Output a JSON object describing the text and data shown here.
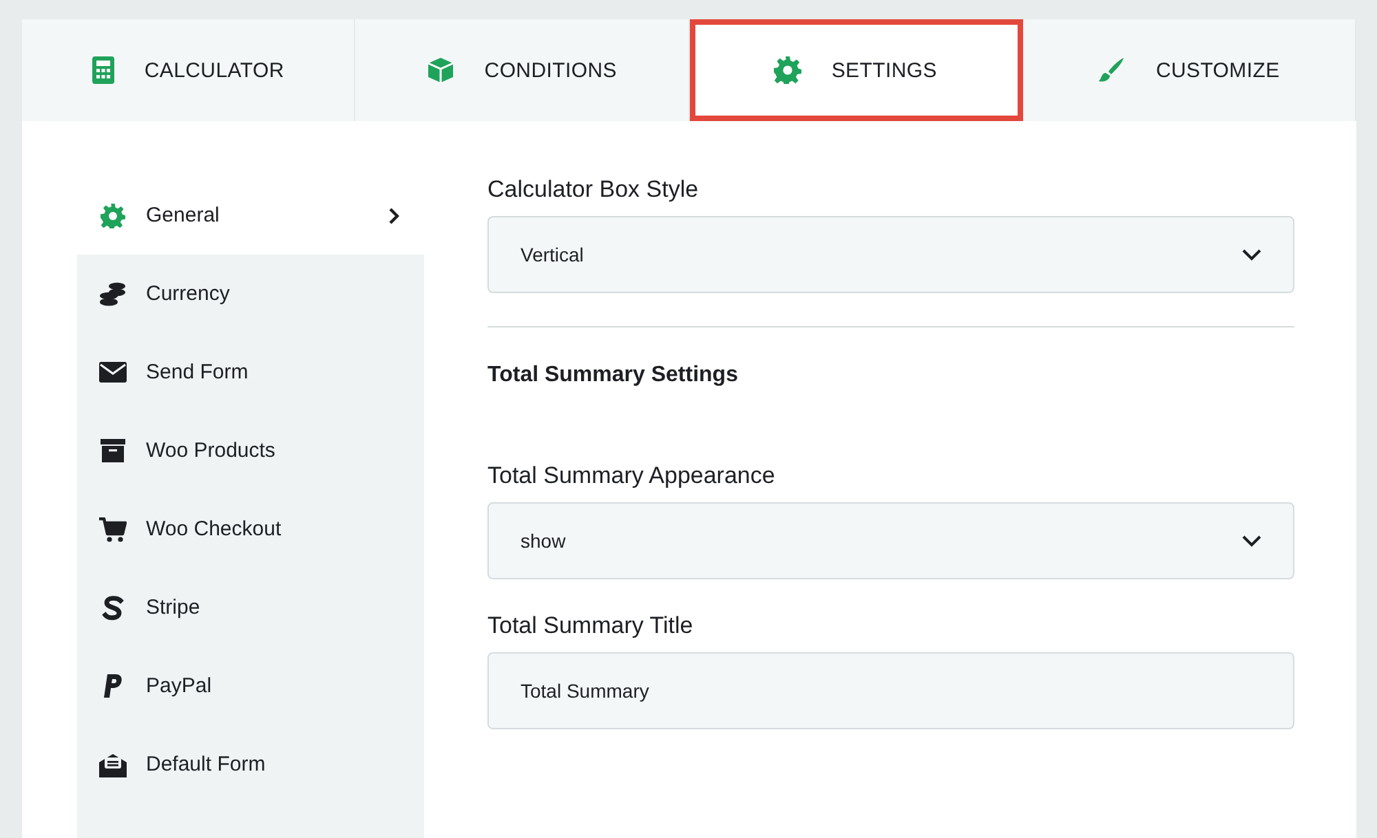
{
  "tabs": [
    {
      "label": "CALCULATOR",
      "selected": false
    },
    {
      "label": "CONDITIONS",
      "selected": false
    },
    {
      "label": "SETTINGS",
      "selected": true
    },
    {
      "label": "CUSTOMIZE",
      "selected": false
    }
  ],
  "sidebar": {
    "items": [
      {
        "label": "General",
        "selected": true
      },
      {
        "label": "Currency",
        "selected": false
      },
      {
        "label": "Send Form",
        "selected": false
      },
      {
        "label": "Woo Products",
        "selected": false
      },
      {
        "label": "Woo Checkout",
        "selected": false
      },
      {
        "label": "Stripe",
        "selected": false
      },
      {
        "label": "PayPal",
        "selected": false
      },
      {
        "label": "Default Form",
        "selected": false
      }
    ]
  },
  "settings": [
    {
      "kind": "select",
      "label": "Calculator Box Style",
      "value": "Vertical"
    },
    {
      "kind": "divider"
    },
    {
      "kind": "heading",
      "label": "Total Summary Settings"
    },
    {
      "kind": "select",
      "label": "Total Summary Appearance",
      "value": "show"
    },
    {
      "kind": "input",
      "label": "Total Summary Title",
      "value": "Total Summary"
    }
  ]
}
